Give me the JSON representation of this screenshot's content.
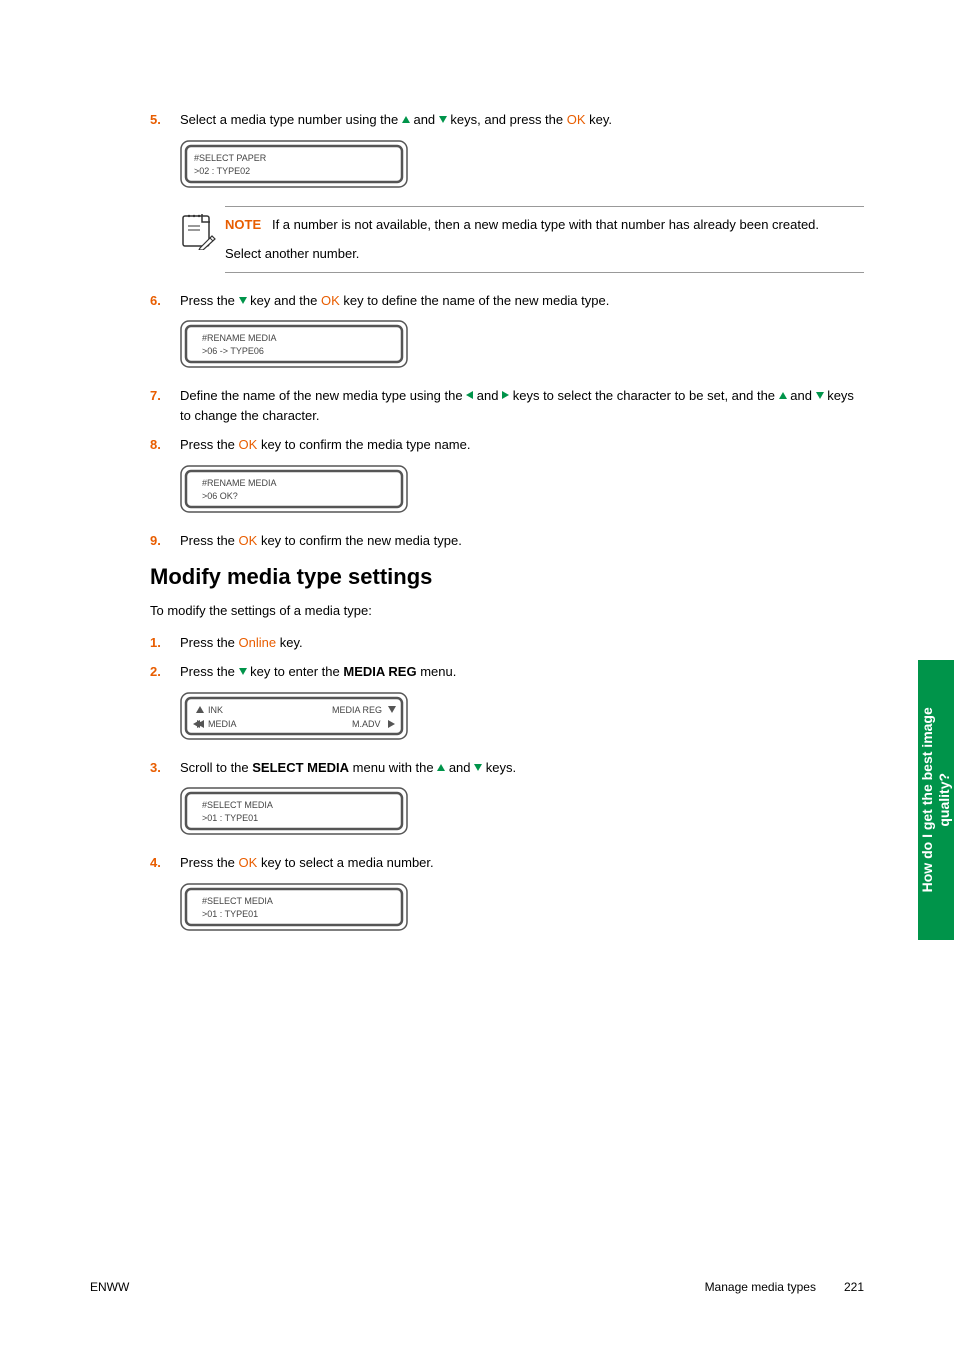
{
  "steps_a": {
    "s5": {
      "num": "5.",
      "pre": "Select a media type number using the ",
      "mid1": " and ",
      "mid2": " keys, and press the ",
      "ok": "OK",
      "post": " key."
    },
    "s6": {
      "num": "6.",
      "pre": "Press the ",
      "mid1": " key and the ",
      "ok": "OK",
      "post": " key to define the name of the new media type."
    },
    "s7": {
      "num": "7.",
      "pre": "Define the name of the new media type using the ",
      "mid1": " and ",
      "mid2": " keys to select the character to be set, and the ",
      "mid3": " and ",
      "post": " keys to change the character."
    },
    "s8": {
      "num": "8.",
      "pre": "Press the ",
      "ok": "OK",
      "post": " key to confirm the media type name."
    },
    "s9": {
      "num": "9.",
      "pre": "Press the ",
      "ok": "OK",
      "post": " key to confirm the new media type."
    }
  },
  "lcd": {
    "screen1": {
      "line1": "#SELECT PAPER",
      "line2": ">02 : TYPE02"
    },
    "screen2": {
      "line1": "#RENAME MEDIA",
      "line2": ">06 -> TYPE06"
    },
    "screen3": {
      "line1": "#RENAME MEDIA",
      "line2": ">06 OK?"
    },
    "screen4": {
      "line1l": "INK",
      "line1r": "MEDIA REG",
      "line2l": "MEDIA",
      "line2r": "M.ADV"
    },
    "screen5": {
      "line1": "#SELECT MEDIA",
      "line2": ">01 : TYPE01"
    },
    "screen6": {
      "line1": "#SELECT MEDIA",
      "line2": ">01 : TYPE01"
    }
  },
  "note": {
    "label": "NOTE",
    "text1": "If a number is not available, then a new media type with that number has already been created.",
    "text2": "Select another number."
  },
  "heading": "Modify media type settings",
  "intro": "To modify the settings of a media type:",
  "steps_b": {
    "s1": {
      "num": "1.",
      "pre": "Press the ",
      "online": "Online",
      "post": " key."
    },
    "s2": {
      "num": "2.",
      "pre": "Press the ",
      "mid1": " key to enter the ",
      "menu": "MEDIA REG",
      "post": " menu."
    },
    "s3": {
      "num": "3.",
      "pre": "Scroll to the ",
      "menu": "SELECT MEDIA",
      "mid1": " menu with the ",
      "mid2": " and ",
      "post": " keys."
    },
    "s4": {
      "num": "4.",
      "pre": "Press the ",
      "ok": "OK",
      "post": " key to select a media number."
    }
  },
  "sidetab": {
    "line1": "How do I get the best image",
    "line2": "quality?"
  },
  "footer": {
    "left": "ENWW",
    "center": "Manage media types",
    "page": "221"
  }
}
